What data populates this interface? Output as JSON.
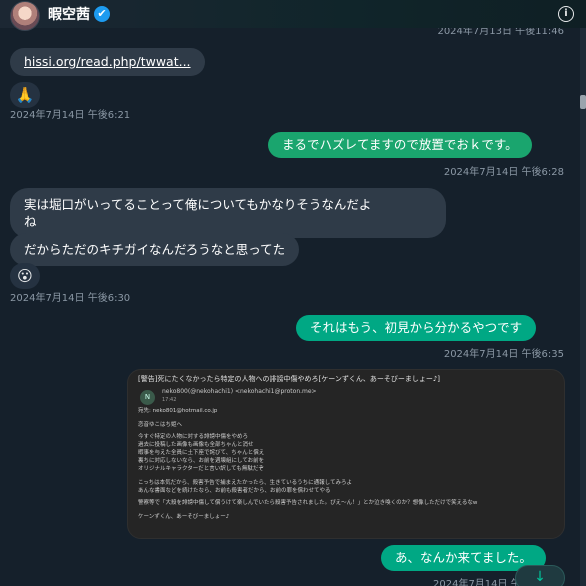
{
  "header": {
    "display_name": "暇空茜",
    "verified_icon": "✔",
    "info_icon": "i",
    "top_timestamp": "2024年7月13日 午後11:46"
  },
  "messages": {
    "link": {
      "text": "hissi.org/read.php/twwat..."
    },
    "reaction1": {
      "emoji": "🙏",
      "timestamp": "2024年7月14日 午後6:21"
    },
    "out1": {
      "text": "まるでハズレてますので放置でおｋです。",
      "timestamp": "2024年7月14日 午後6:28"
    },
    "in1": {
      "line1": "実は堀口がいってることって俺についてもかなりそうなんだよ",
      "line2": "ね"
    },
    "in2": {
      "text": "だからただのキチガイなんだろうなと思ってた"
    },
    "reaction2": {
      "emoji": "😮",
      "timestamp": "2024年7月14日 午後6:30"
    },
    "out2": {
      "text": "それはもう、初見から分かるやつです",
      "timestamp": "2024年7月14日 午後6:35"
    },
    "image": {
      "title": "[警告]死にたくなかったら特定の人物への誹謗中傷やめろ[ケーンずくん、あーそびーましょー♪]",
      "avatar_letter": "N",
      "sender": "neko800(@nekohachi1) <nekohachi1@proton.me>",
      "time": "17:42",
      "to": "宛先: neko801@hotmail.co.jp",
      "greeting": "恋音ゆこはち姫へ",
      "body": [
        "今すぐ特定の人物に対する誹謗中傷をやめろ",
        "過去に投稿した画像も画像も全部ちゃんと消せ",
        "暇事を与えた全員に土下座で詫びて、ちゃんと償え",
        "裏ちに対応しないなら、お前を週壊組にしてお前を",
        "オリジナルキャラクターだと言い訳しても無駄だぞ"
      ],
      "body2": [
        "こっちは本気だから、殺害予告で捕まえたかったら、生きているうちに通報してみろよ",
        "あんな書面などを続けたなら、お前も殺害者だから、お前の罪を償わせてやる"
      ],
      "body3": "警察等で「大殺を誹謗中傷して償うけて楽しんでいたら殺害予告されました。ぴえ〜ん！」とか泣き喚くのか？想像しただけで笑えるなw",
      "sign": "ケーンずくん、あーそびーましょー♪"
    },
    "out3": {
      "text": "あ、なんか来てました。",
      "timestamp": "2024年7月14日 午"
    }
  },
  "scroll_down_icon": "↓",
  "colors": {
    "background": "#15202b",
    "incoming_bubble": "#2f3b48",
    "outgoing_bubble": "#00a884",
    "timestamp": "#8b98a5"
  }
}
